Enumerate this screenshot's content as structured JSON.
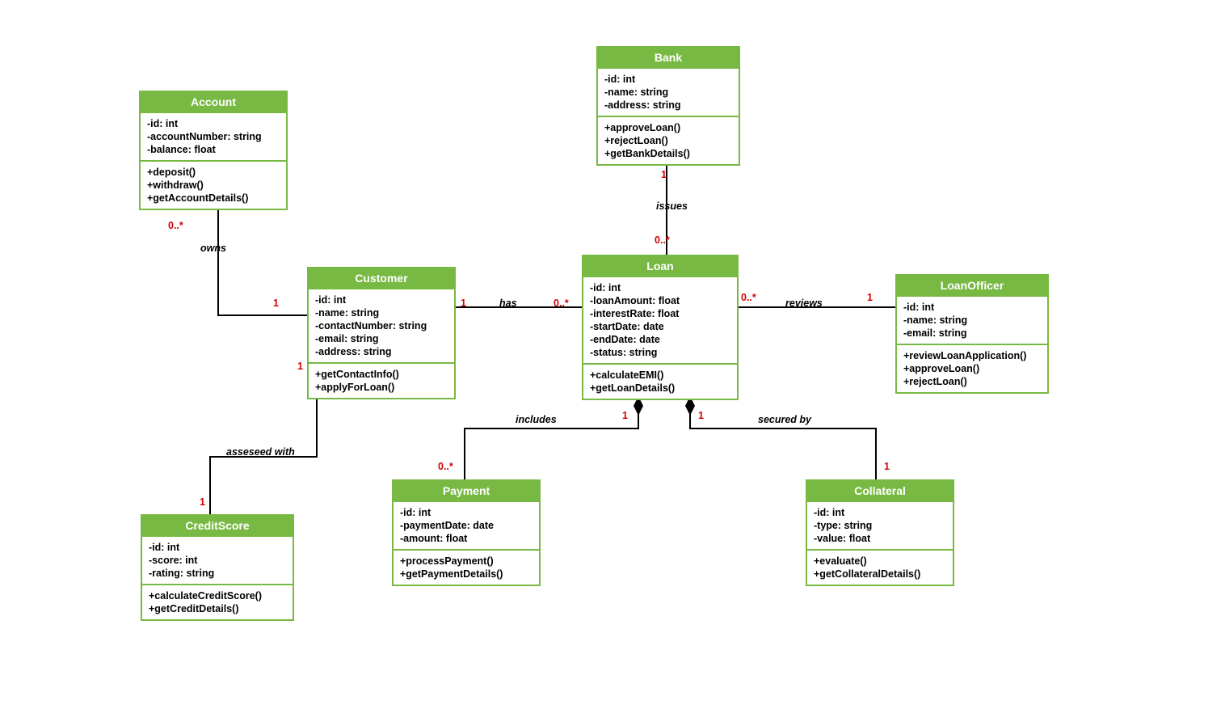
{
  "classes": {
    "account": {
      "name": "Account",
      "attrs": [
        "-id: int",
        "-accountNumber: string",
        "-balance: float"
      ],
      "ops": [
        "+deposit()",
        "+withdraw()",
        "+getAccountDetails()"
      ]
    },
    "customer": {
      "name": "Customer",
      "attrs": [
        "-id: int",
        "-name: string",
        "-contactNumber: string",
        "-email: string",
        "-address: string"
      ],
      "ops": [
        "+getContactInfo()",
        "+applyForLoan()"
      ]
    },
    "bank": {
      "name": "Bank",
      "attrs": [
        "-id: int",
        "-name: string",
        "-address: string"
      ],
      "ops": [
        "+approveLoan()",
        "+rejectLoan()",
        "+getBankDetails()"
      ]
    },
    "loan": {
      "name": "Loan",
      "attrs": [
        "-id: int",
        "-loanAmount: float",
        "-interestRate: float",
        "-startDate: date",
        "-endDate: date",
        "-status: string"
      ],
      "ops": [
        "+calculateEMI()",
        "+getLoanDetails()"
      ]
    },
    "loanOfficer": {
      "name": "LoanOfficer",
      "attrs": [
        "-id: int",
        "-name: string",
        "-email: string"
      ],
      "ops": [
        "+reviewLoanApplication()",
        "+approveLoan()",
        "+rejectLoan()"
      ]
    },
    "creditScore": {
      "name": "CreditScore",
      "attrs": [
        "-id: int",
        "-score: int",
        "-rating: string"
      ],
      "ops": [
        "+calculateCreditScore()",
        "+getCreditDetails()"
      ]
    },
    "payment": {
      "name": "Payment",
      "attrs": [
        "-id: int",
        "-paymentDate: date",
        "-amount: float"
      ],
      "ops": [
        "+processPayment()",
        "+getPaymentDetails()"
      ]
    },
    "collateral": {
      "name": "Collateral",
      "attrs": [
        "-id: int",
        "-type: string",
        "-value: float"
      ],
      "ops": [
        "+evaluate()",
        "+getCollateralDetails()"
      ]
    }
  },
  "relations": {
    "owns": {
      "label": "owns",
      "m1": "0..*",
      "m2": "1"
    },
    "has": {
      "label": "has",
      "m1": "1",
      "m2": "0..*"
    },
    "issues": {
      "label": "issues",
      "m1": "1",
      "m2": "0..*"
    },
    "reviews": {
      "label": "reviews",
      "m1": "0..*",
      "m2": "1"
    },
    "assessed": {
      "label": "asseseed with",
      "m1": "1",
      "m2": "1"
    },
    "includes": {
      "label": "includes",
      "m1": "1",
      "m2": "0..*"
    },
    "secured": {
      "label": "secured by",
      "m1": "1",
      "m2": "1"
    }
  }
}
